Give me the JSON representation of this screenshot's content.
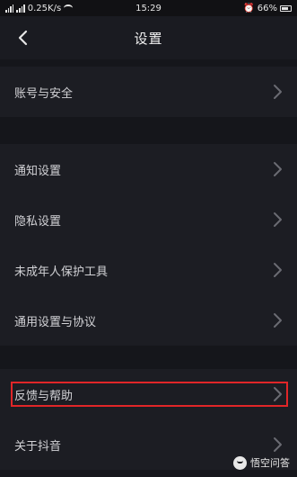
{
  "status_bar": {
    "carrier_left": "46",
    "speed": "0.25K/s",
    "time": "15:29",
    "battery": "66%"
  },
  "header": {
    "title": "设置"
  },
  "groups": [
    {
      "items": [
        {
          "label": "账号与安全"
        }
      ]
    },
    {
      "items": [
        {
          "label": "通知设置"
        },
        {
          "label": "隐私设置"
        },
        {
          "label": "未成年人保护工具"
        },
        {
          "label": "通用设置与协议"
        }
      ]
    },
    {
      "items": [
        {
          "label": "反馈与帮助",
          "highlighted": true
        },
        {
          "label": "关于抖音"
        }
      ]
    }
  ],
  "watermark": {
    "text": "悟空问答"
  },
  "colors": {
    "background": "#16171c",
    "highlight_border": "#e02628"
  }
}
